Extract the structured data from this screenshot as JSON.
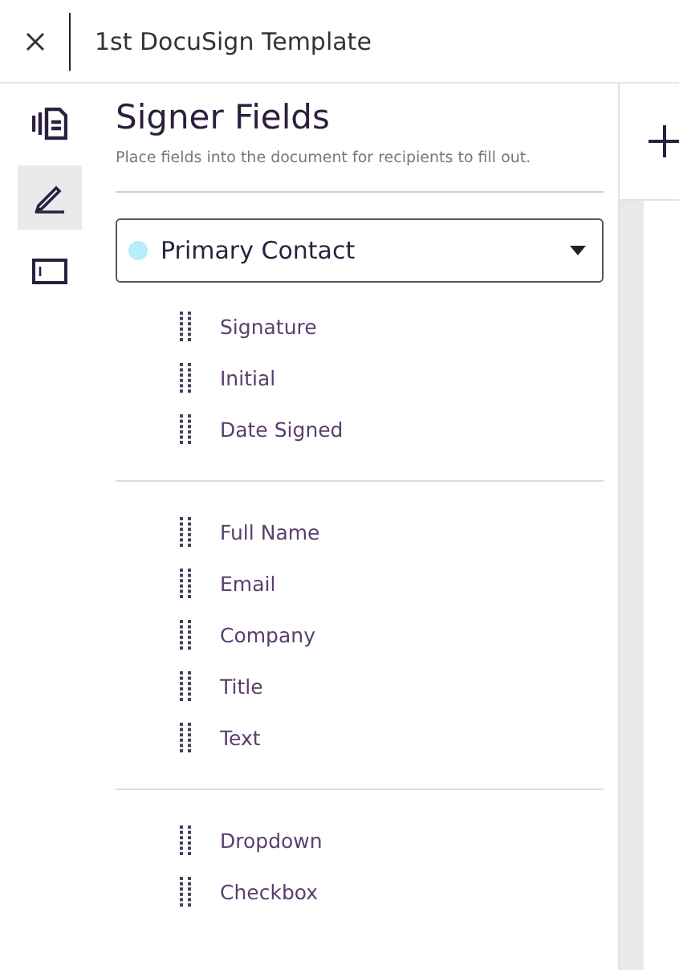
{
  "header": {
    "title": "1st DocuSign Template"
  },
  "rail": [
    {
      "kind": "pages",
      "selected": false
    },
    {
      "kind": "fields",
      "selected": true
    },
    {
      "kind": "panel",
      "selected": false
    }
  ],
  "panel": {
    "title": "Signer Fields",
    "subtitle": "Place fields into the document for recipients to fill out.",
    "recipient": {
      "name": "Primary Contact",
      "color": "#b7ecfa"
    },
    "groups": [
      {
        "fields": [
          "Signature",
          "Initial",
          "Date Signed"
        ]
      },
      {
        "fields": [
          "Full Name",
          "Email",
          "Company",
          "Title",
          "Text"
        ]
      },
      {
        "fields": [
          "Dropdown",
          "Checkbox"
        ]
      }
    ]
  }
}
